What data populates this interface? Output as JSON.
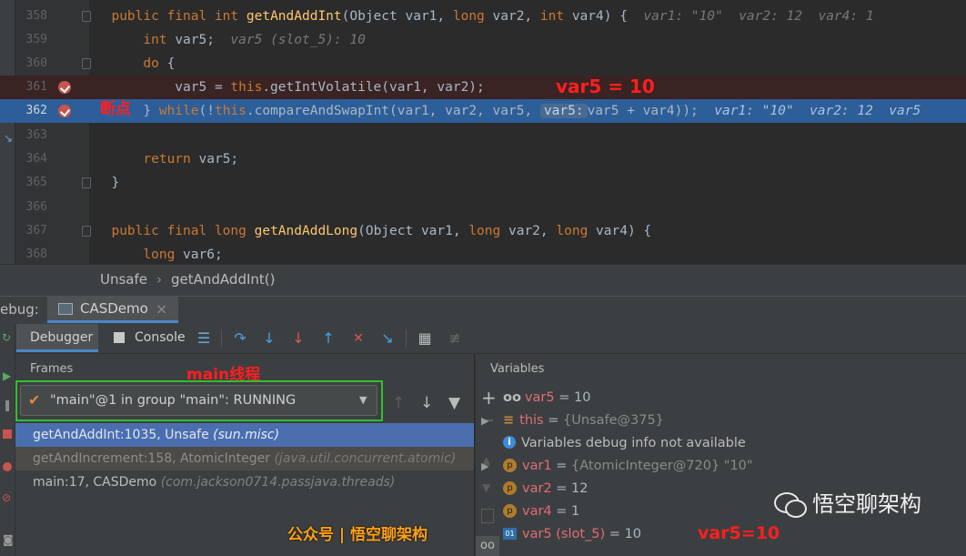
{
  "editor": {
    "lines": [
      {
        "num": "358",
        "segments": [
          [
            "  ",
            "t"
          ],
          [
            "public final int ",
            "kw"
          ],
          [
            "getAndAddInt",
            "fn"
          ],
          [
            "(Object var1, ",
            "t"
          ],
          [
            "long ",
            "kw"
          ],
          [
            "var2, ",
            "t"
          ],
          [
            "int ",
            "kw"
          ],
          [
            "var4) {  ",
            "t"
          ],
          [
            "var1: \"10\"  var2: 12  var4: 1",
            "hint"
          ]
        ]
      },
      {
        "num": "359",
        "segments": [
          [
            "      ",
            "t"
          ],
          [
            "int ",
            "kw"
          ],
          [
            "var5;  ",
            "t"
          ],
          [
            "var5 (slot_5): 10",
            "hint"
          ]
        ]
      },
      {
        "num": "360",
        "segments": [
          [
            "      ",
            "t"
          ],
          [
            "do ",
            "kw"
          ],
          [
            "{",
            "t"
          ]
        ]
      },
      {
        "num": "361",
        "segments": [
          [
            "          var5 = ",
            "t"
          ],
          [
            "this",
            "kw"
          ],
          [
            ".getIntVolatile(var1, var2);",
            "t"
          ]
        ]
      },
      {
        "num": "362",
        "segments": [
          [
            "      } ",
            "t"
          ],
          [
            "while",
            "kw"
          ],
          [
            "(!",
            "t"
          ],
          [
            "this",
            "kw"
          ],
          [
            ".compareAndSwapInt(var1, var2, var5, ",
            "t"
          ],
          [
            "var5:",
            "inlay"
          ],
          [
            "var5 + var4));  ",
            "t"
          ],
          [
            "var1: \"10\"  var2: 12  var5",
            "hint"
          ]
        ]
      },
      {
        "num": "363",
        "segments": []
      },
      {
        "num": "364",
        "segments": [
          [
            "      ",
            "t"
          ],
          [
            "return ",
            "kw"
          ],
          [
            "var5;",
            "t"
          ]
        ]
      },
      {
        "num": "365",
        "segments": [
          [
            "  }",
            "t"
          ]
        ]
      },
      {
        "num": "366",
        "segments": []
      },
      {
        "num": "367",
        "segments": [
          [
            "  ",
            "t"
          ],
          [
            "public final long ",
            "kw"
          ],
          [
            "getAndAddLong",
            "fn"
          ],
          [
            "(Object var1, ",
            "t"
          ],
          [
            "long ",
            "kw"
          ],
          [
            "var2, ",
            "t"
          ],
          [
            "long ",
            "kw"
          ],
          [
            "var4) {",
            "t"
          ]
        ]
      },
      {
        "num": "368",
        "segments": [
          [
            "      ",
            "t"
          ],
          [
            "long ",
            "kw"
          ],
          [
            "var6;",
            "t"
          ]
        ]
      }
    ],
    "annotation_var5": "var5 = 10",
    "annotation_breakpoint": "断点"
  },
  "breadcrumb": {
    "class_name": "Unsafe",
    "separator": "›",
    "method": "getAndAddInt()"
  },
  "debug": {
    "label": "ebug:",
    "session_tab": "CASDemo",
    "close_glyph": "×",
    "tabs": {
      "debugger": "Debugger",
      "console": "Console"
    },
    "frames_title": "Frames",
    "thread_select": "\"main\"@1 in group \"main\": RUNNING",
    "annotation_main": "main线程",
    "frames": [
      {
        "method": "getAndAddInt:1035, Unsafe",
        "pkg": "(sun.misc)"
      },
      {
        "method": "getAndIncrement:158, AtomicInteger",
        "pkg": "(java.util.concurrent.atomic)"
      },
      {
        "method": "main:17, CASDemo",
        "pkg": "(com.jackson0714.passjava.threads)"
      }
    ],
    "variables_title": "Variables",
    "variables": [
      {
        "icon": "watch-icon",
        "name": "var5",
        "sep": " = ",
        "value": "10"
      },
      {
        "icon": "field-icon",
        "name": "this",
        "sep": " = ",
        "value": "{Unsafe@375}"
      },
      {
        "icon": "info-icon",
        "name": "",
        "sep": "",
        "value": "Variables debug info not available"
      },
      {
        "icon": "param-icon",
        "name": "var1",
        "sep": " = ",
        "value": "{AtomicInteger@720} \"10\""
      },
      {
        "icon": "param-icon",
        "name": "var2",
        "sep": " = ",
        "value": "12"
      },
      {
        "icon": "param-icon",
        "name": "var4",
        "sep": " = ",
        "value": "1"
      },
      {
        "icon": "local-icon",
        "name": "var5 (slot_5)",
        "sep": " = ",
        "value": "10"
      }
    ],
    "annotation_var5_bottom": "var5=10"
  },
  "watermark": {
    "left": "公众号 | 悟空聊架构",
    "right": "悟空聊架构"
  }
}
